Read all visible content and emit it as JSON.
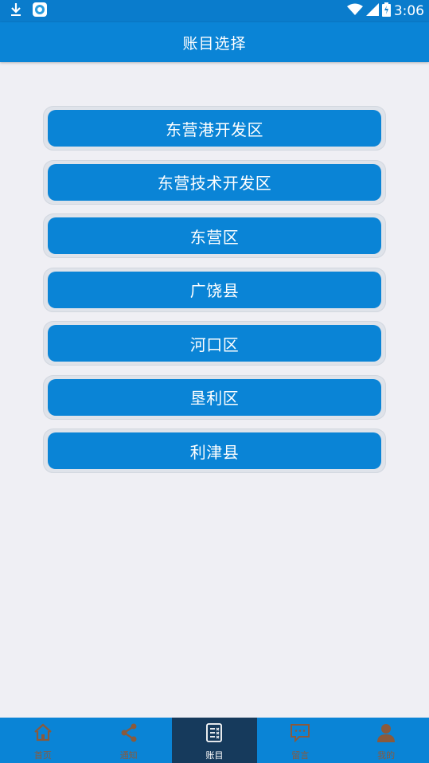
{
  "status_bar": {
    "time": "3:06",
    "icons": [
      "download-icon",
      "app-notification-icon",
      "wifi-icon",
      "signal-icon",
      "battery-charging-icon"
    ]
  },
  "header": {
    "title": "账目选择"
  },
  "list": {
    "items": [
      {
        "label": "东营港开发区"
      },
      {
        "label": "东营技术开发区"
      },
      {
        "label": "东营区"
      },
      {
        "label": "广饶县"
      },
      {
        "label": "河口区"
      },
      {
        "label": "垦利区"
      },
      {
        "label": "利津县"
      }
    ]
  },
  "tab_bar": {
    "active_index": 2,
    "tabs": [
      {
        "label": "首页",
        "icon": "home-icon"
      },
      {
        "label": "通知",
        "icon": "share-icon"
      },
      {
        "label": "账目",
        "icon": "ledger-icon"
      },
      {
        "label": "留言",
        "icon": "message-icon"
      },
      {
        "label": "我的",
        "icon": "person-icon"
      }
    ]
  },
  "colors": {
    "primary": "#0a84d6",
    "active_tab": "#163a5c",
    "inactive_tab_icon": "#8a5a3c",
    "background": "#efeff4"
  }
}
